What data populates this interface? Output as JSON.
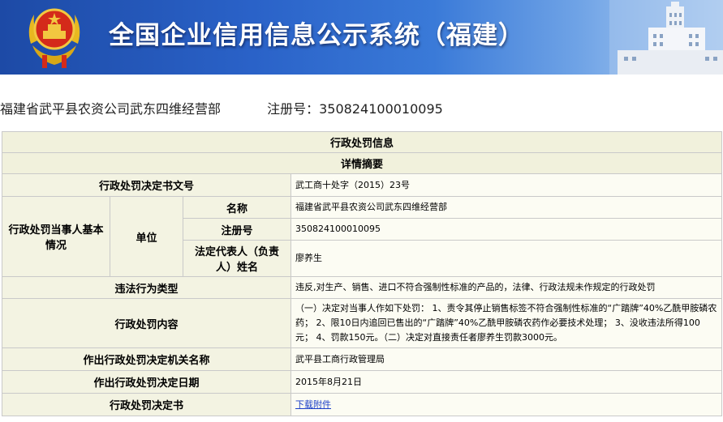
{
  "header": {
    "title": "全国企业信用信息公示系统（福建）"
  },
  "company": {
    "name": "福建省武平县农资公司武东四维经营部",
    "reg_label": "注册号：",
    "reg_no": "350824100010095"
  },
  "section": {
    "title": "行政处罚信息",
    "subtitle": "详情摘要"
  },
  "rows": {
    "decision_no": {
      "label": "行政处罚决定书文号",
      "value": "武工商十处字（2015）23号"
    },
    "party": {
      "label": "行政处罚当事人基本情况",
      "unit_label": "单位",
      "name_label": "名称",
      "name_value": "福建省武平县农资公司武东四维经营部",
      "reg_label": "注册号",
      "reg_value": "350824100010095",
      "rep_label": "法定代表人（负责人）姓名",
      "rep_value": "廖养生"
    },
    "violation": {
      "label": "违法行为类型",
      "value": "违反,对生产、销售、进口不符合强制性标准的产品的，法律、行政法规未作规定的行政处罚"
    },
    "content": {
      "label": "行政处罚内容",
      "value": "（一）决定对当事人作如下处罚： 1、责令其停止销售标签不符合强制性标准的“广踏牌”40%乙酰甲胺磷农药； 2、限10日内追回已售出的“广踏牌”40%乙酰甲胺磷农药作必要技术处理； 3、没收违法所得100元； 4、罚款150元。（二）决定对直接责任者廖养生罚款3000元。"
    },
    "authority": {
      "label": "作出行政处罚决定机关名称",
      "value": "武平县工商行政管理局"
    },
    "date": {
      "label": "作出行政处罚决定日期",
      "value": "2015年8月21日"
    },
    "document": {
      "label": "行政处罚决定书",
      "link": "下载附件"
    }
  },
  "colors": {
    "banner_dark": "#1d4aa6",
    "banner_light": "#b9d4f3",
    "cell_bg": "#f7f7ec",
    "link": "#1a3ec8"
  }
}
